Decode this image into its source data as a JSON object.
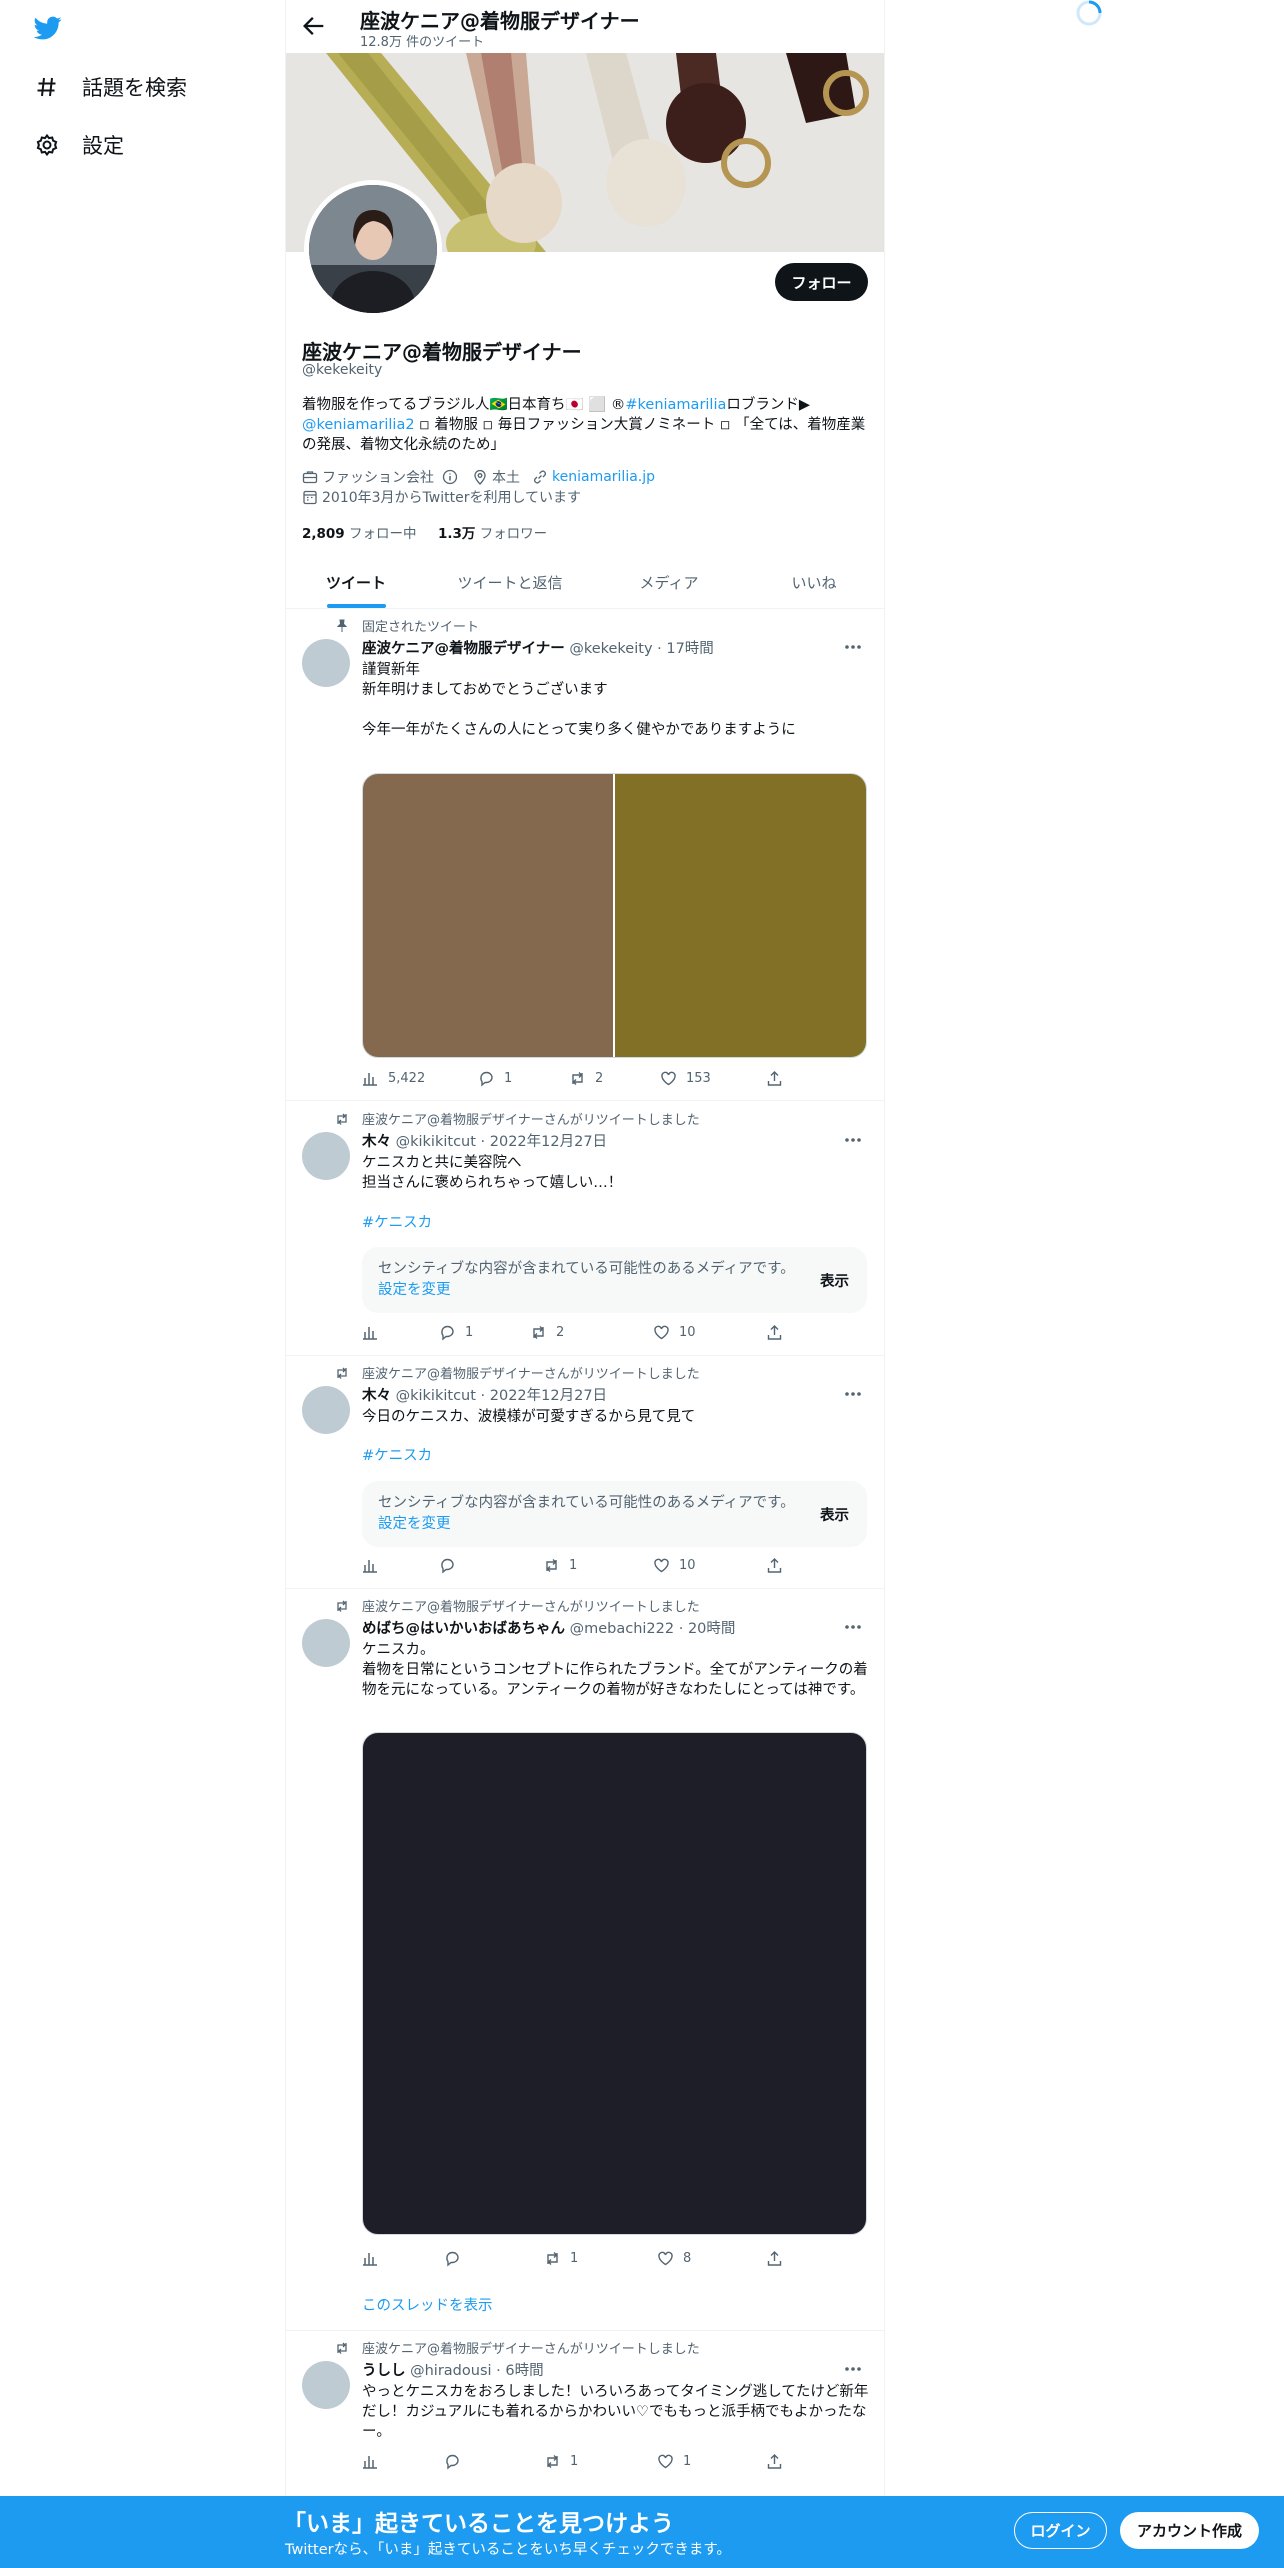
{
  "nav": {
    "logo_icon": "twitter-bird-icon",
    "items": [
      {
        "label": "話題を検索",
        "icon": "hashtag-icon"
      },
      {
        "label": "設定",
        "icon": "gear-icon"
      }
    ]
  },
  "header": {
    "title": "座波ケニア@着物服デザイナー",
    "tweet_count": "12.8万 件のツイート"
  },
  "profile": {
    "follow_label": "フォロー",
    "name": "座波ケニア@着物服デザイナー",
    "handle": "@kekekeity",
    "bio": {
      "part1": "着物服を作ってるブラジル人🇧🇷日本育ち🇯🇵 ⬜ ®",
      "hashtag": "#keniamarilia",
      "part2": "ロブランド▶",
      "mention": "@keniamarilia2",
      "part3": " ◽ 着物服 ◽ 毎日ファッション大賞ノミネート ◽ 「全ては、着物産業の発展、着物文化永続のため」"
    },
    "category": "ファッション会社",
    "location": "本土",
    "website": "keniamarilia.jp",
    "joined": "2010年3月からTwitterを利用しています",
    "following_count": "2,809",
    "following_label": "フォロー中",
    "followers_count": "1.3万",
    "followers_label": "フォロワー"
  },
  "tabs": [
    {
      "label": "ツイート",
      "active": true
    },
    {
      "label": "ツイートと返信",
      "active": false
    },
    {
      "label": "メディア",
      "active": false
    },
    {
      "label": "いいね",
      "active": false
    }
  ],
  "tweets": [
    {
      "context": "固定されたツイート",
      "name": "座波ケニア@着物服デザイナー",
      "handle": "@kekekeity",
      "time": "· 17時間",
      "lines": [
        "謹賀新年",
        "新年明けましておめでとうございます",
        "",
        "今年一年がたくさんの人にとって実り多く健やかでありますように"
      ],
      "media_colors": [
        "#84694e",
        "#827026"
      ],
      "views": "5,422",
      "replies": "1",
      "retweets": "2",
      "likes": "153"
    },
    {
      "context": "座波ケニア@着物服デザイナーさんがリツイートしました",
      "name": "木々",
      "handle": "@kikikitcut",
      "time": "· 2022年12月27日",
      "lines": [
        "ケニスカと共に美容院へ",
        "担当さんに褒められちゃって嬉しい…！"
      ],
      "hashtag": "#ケニスカ",
      "sensitive_text": "センシティブな内容が含まれている可能性のあるメディアです。",
      "sensitive_link": "設定を変更",
      "sensitive_button": "表示",
      "views": "",
      "replies": "1",
      "retweets": "2",
      "likes": "10"
    },
    {
      "context": "座波ケニア@着物服デザイナーさんがリツイートしました",
      "name": "木々",
      "handle": "@kikikitcut",
      "time": "· 2022年12月27日",
      "lines": [
        "今日のケニスカ、波模様が可愛すぎるから見て見て"
      ],
      "hashtag": "#ケニスカ",
      "sensitive_text": "センシティブな内容が含まれている可能性のあるメディアです。",
      "sensitive_link": "設定を変更",
      "sensitive_button": "表示",
      "views": "",
      "replies": "",
      "retweets": "1",
      "likes": "10"
    },
    {
      "context": "座波ケニア@着物服デザイナーさんがリツイートしました",
      "name": "めばち@はいかいおばあちゃん",
      "handle": "@mebachi222",
      "time": "· 20時間",
      "lines": [
        "ケニスカ。",
        "着物を日常にというコンセプトに作られたブランド。全てがアンティークの着物を元になっている。アンティークの着物が好きなわたしにとっては神です。"
      ],
      "media_color": "#1e1e28",
      "views": "",
      "replies": "",
      "retweets": "1",
      "likes": "8",
      "show_thread": "このスレッドを表示"
    },
    {
      "context": "座波ケニア@着物服デザイナーさんがリツイートしました",
      "name": "うしし",
      "handle": "@hiradousi",
      "time": "· 6時間",
      "lines": [
        "やっとケニスカをおろしました！いろいろあってタイミング逃してたけど新年だし！カジュアルにも着れるからかわいい♡でももっと派手柄でもよかったなー。"
      ],
      "views": "",
      "replies": "",
      "retweets": "1",
      "likes": "1"
    }
  ],
  "bottom_bar": {
    "title": "「いま」起きていることを見つけよう",
    "subtitle": "Twitterなら、「いま」起きていることをいち早くチェックできます。",
    "login": "ログイン",
    "signup": "アカウント作成"
  },
  "colors": {
    "accent": "#1d9bf0",
    "text": "#0f1419",
    "muted": "#536471"
  }
}
